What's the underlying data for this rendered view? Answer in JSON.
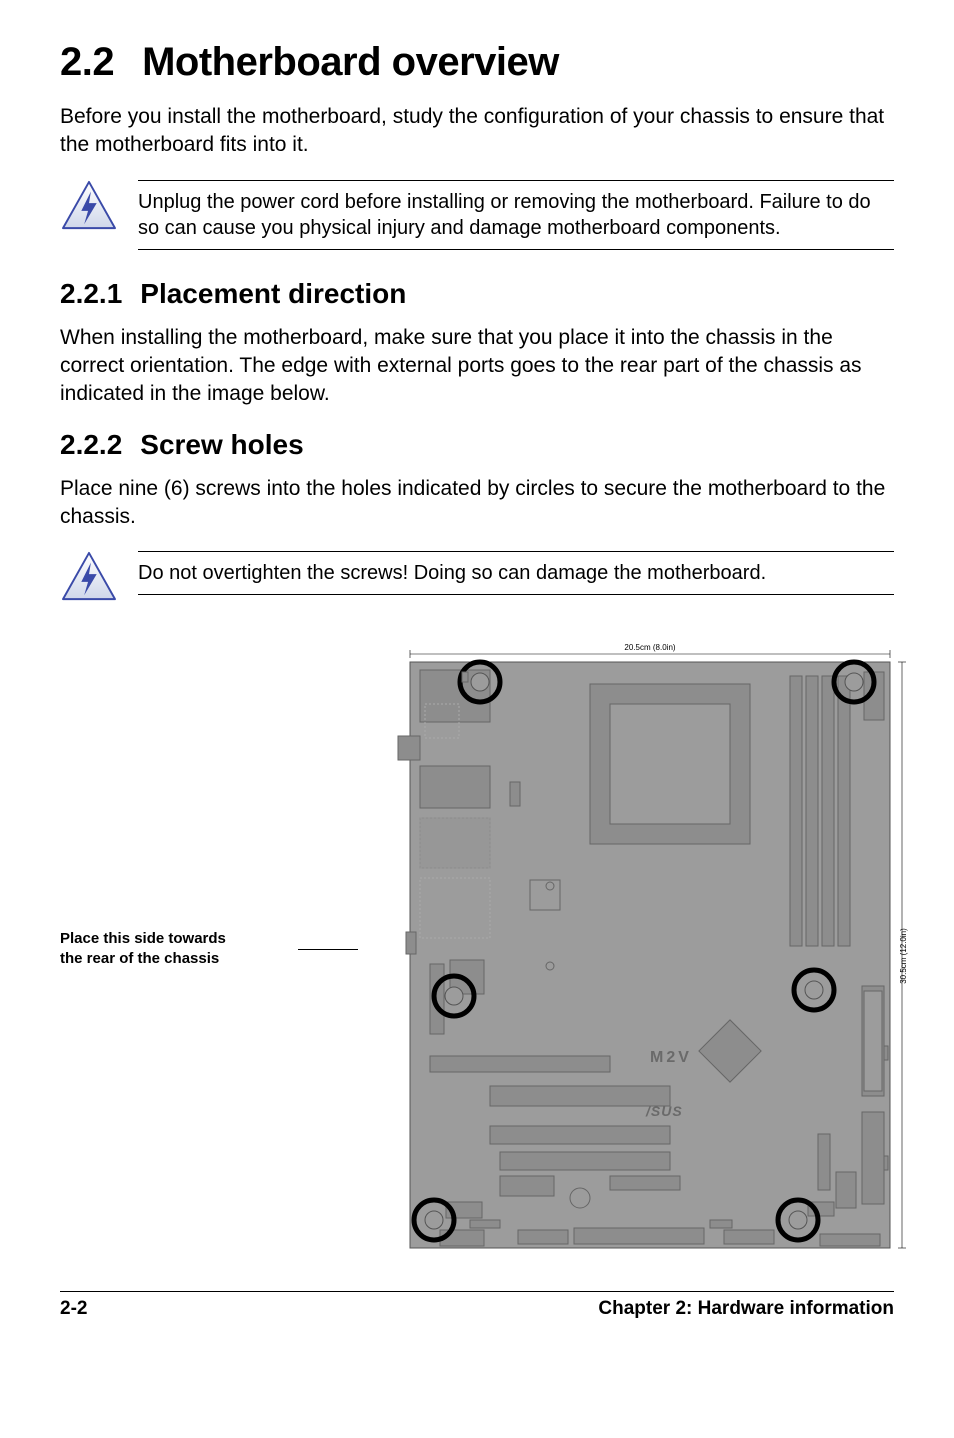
{
  "title_num": "2.2",
  "title_text": "Motherboard overview",
  "intro": "Before you install the motherboard, study the configuration of your chassis to ensure that the motherboard fits into it.",
  "warn1": "Unplug the power cord before installing or removing the motherboard. Failure to do so can cause you physical injury and damage motherboard components.",
  "sec1_num": "2.2.1",
  "sec1_title": "Placement direction",
  "sec1_body": "When installing the motherboard, make sure that you place it into the chassis in the correct orientation. The edge with external ports goes to the rear part of the chassis as indicated in the image below.",
  "sec2_num": "2.2.2",
  "sec2_title": "Screw holes",
  "sec2_body": "Place nine (6) screws into the holes indicated by circles to secure the motherboard to the chassis.",
  "warn2": "Do not overtighten the screws! Doing so can damage the motherboard.",
  "fig_caption_l1": "Place this side towards",
  "fig_caption_l2": "the rear of the chassis",
  "fig_dim_top": "20.5cm (8.0in)",
  "fig_dim_right": "30.5cm (12.0in)",
  "fig_model": "M2V",
  "fig_brand": "/SUS",
  "footer_left": "2-2",
  "footer_right": "Chapter 2: Hardware information"
}
